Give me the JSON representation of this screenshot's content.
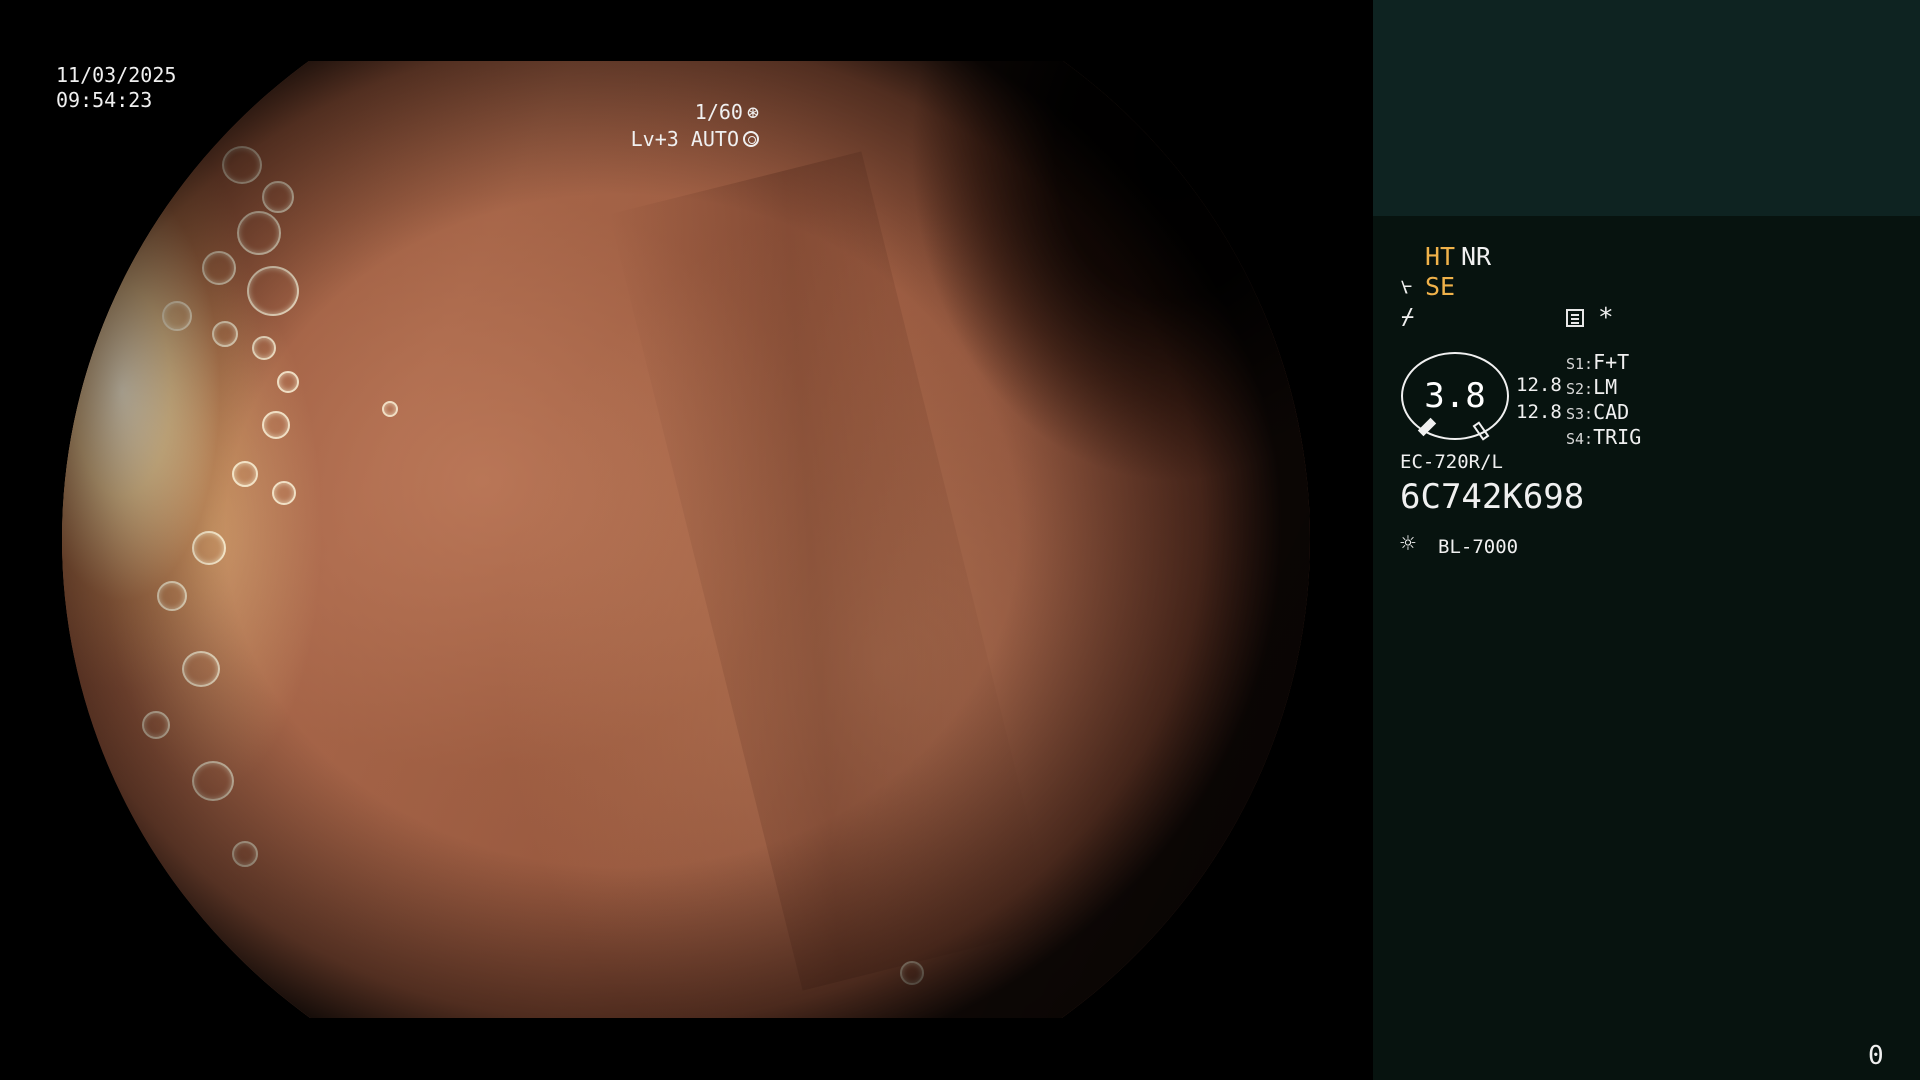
{
  "overlay": {
    "date": "11/03/2025",
    "time": "09:54:23",
    "shutter": "1/60",
    "exposure": "Lv+3 AUTO"
  },
  "panel": {
    "ht": "HT",
    "nr": "NR",
    "se": "SE",
    "star": "*",
    "gauge_value": "3.8",
    "gauge_top": "12.8",
    "gauge_bottom": "12.8",
    "switches": [
      {
        "key": "S1:",
        "value": "F+T"
      },
      {
        "key": "S2:",
        "value": "LM"
      },
      {
        "key": "S3:",
        "value": "CAD"
      },
      {
        "key": "S4:",
        "value": "TRIG"
      }
    ],
    "scope_model": "EC-720R/L",
    "serial": "6C742K698",
    "light_source": "BL-7000",
    "counter": "0"
  },
  "icons": {
    "shutter_icon": "aperture-icon",
    "exposure_icon": "iris-icon",
    "se_icon": "structure-enhance-icon",
    "edge_icon": "edge-icon",
    "doc_icon": "settings-list-icon",
    "light_icon": "sun-icon"
  },
  "colors": {
    "panel_bg": "#07130f",
    "panel_top_bg": "#0e2321",
    "accent": "#f0b24a"
  }
}
